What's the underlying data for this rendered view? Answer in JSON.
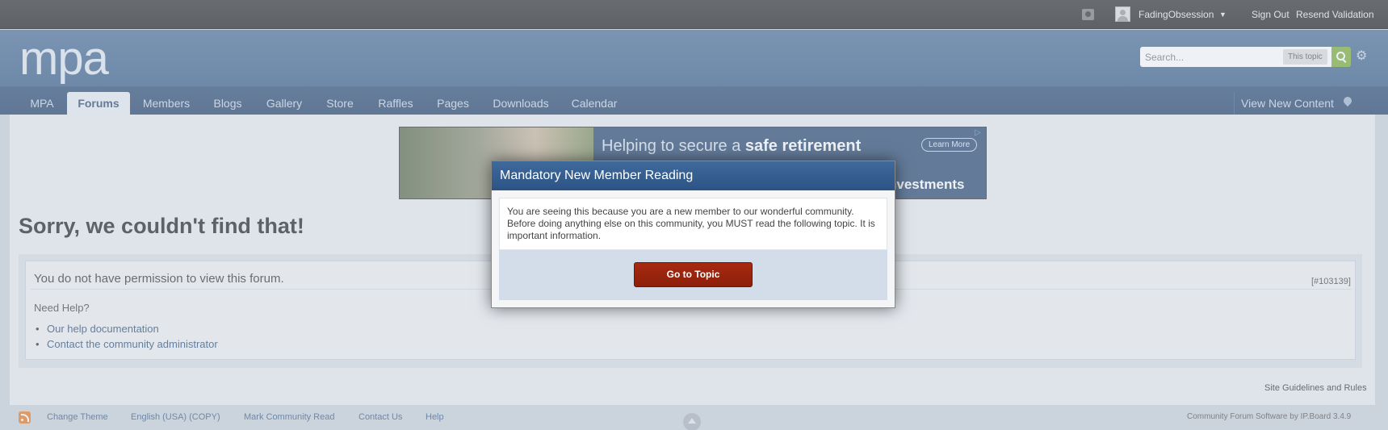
{
  "userbar": {
    "username": "FadingObsession",
    "sign_out": "Sign Out",
    "resend_validation": "Resend Validation"
  },
  "branding": {
    "logo": "mpa",
    "search_placeholder": "Search...",
    "search_scope": "This topic"
  },
  "nav": {
    "tabs": [
      "MPA",
      "Forums",
      "Members",
      "Blogs",
      "Gallery",
      "Store",
      "Raffles",
      "Pages",
      "Downloads",
      "Calendar"
    ],
    "active_tab": "Forums",
    "view_new_content": "View New Content"
  },
  "ad": {
    "text_prefix": "Helping to secure a ",
    "text_bold": "safe retirement",
    "learn_more": "Learn More",
    "tagline": "nvestments"
  },
  "main": {
    "error_title": "Sorry, we couldn't find that!",
    "permission_message": "You do not have permission to view this forum.",
    "error_code": "[#103139]",
    "need_help": "Need Help?",
    "help_links": [
      "Our help documentation",
      "Contact the community administrator"
    ],
    "guidelines": "Site Guidelines and Rules"
  },
  "footer": {
    "links": [
      "Change Theme",
      "English (USA) (COPY)",
      "Mark Community Read",
      "Contact Us",
      "Help"
    ],
    "powered_by": "Community Forum Software by IP.Board 3.4.9"
  },
  "modal": {
    "title": "Mandatory New Member Reading",
    "body": "You are seeing this because you are a new member to our wonderful community. Before doing anything else on this community, you MUST read the following topic. It is important information.",
    "button": "Go to Topic"
  },
  "colors": {
    "nav_bg": "#2e4f77",
    "branding_bg": "#4e7199",
    "button_red": "#a72a10",
    "search_green": "#7cae3a"
  }
}
